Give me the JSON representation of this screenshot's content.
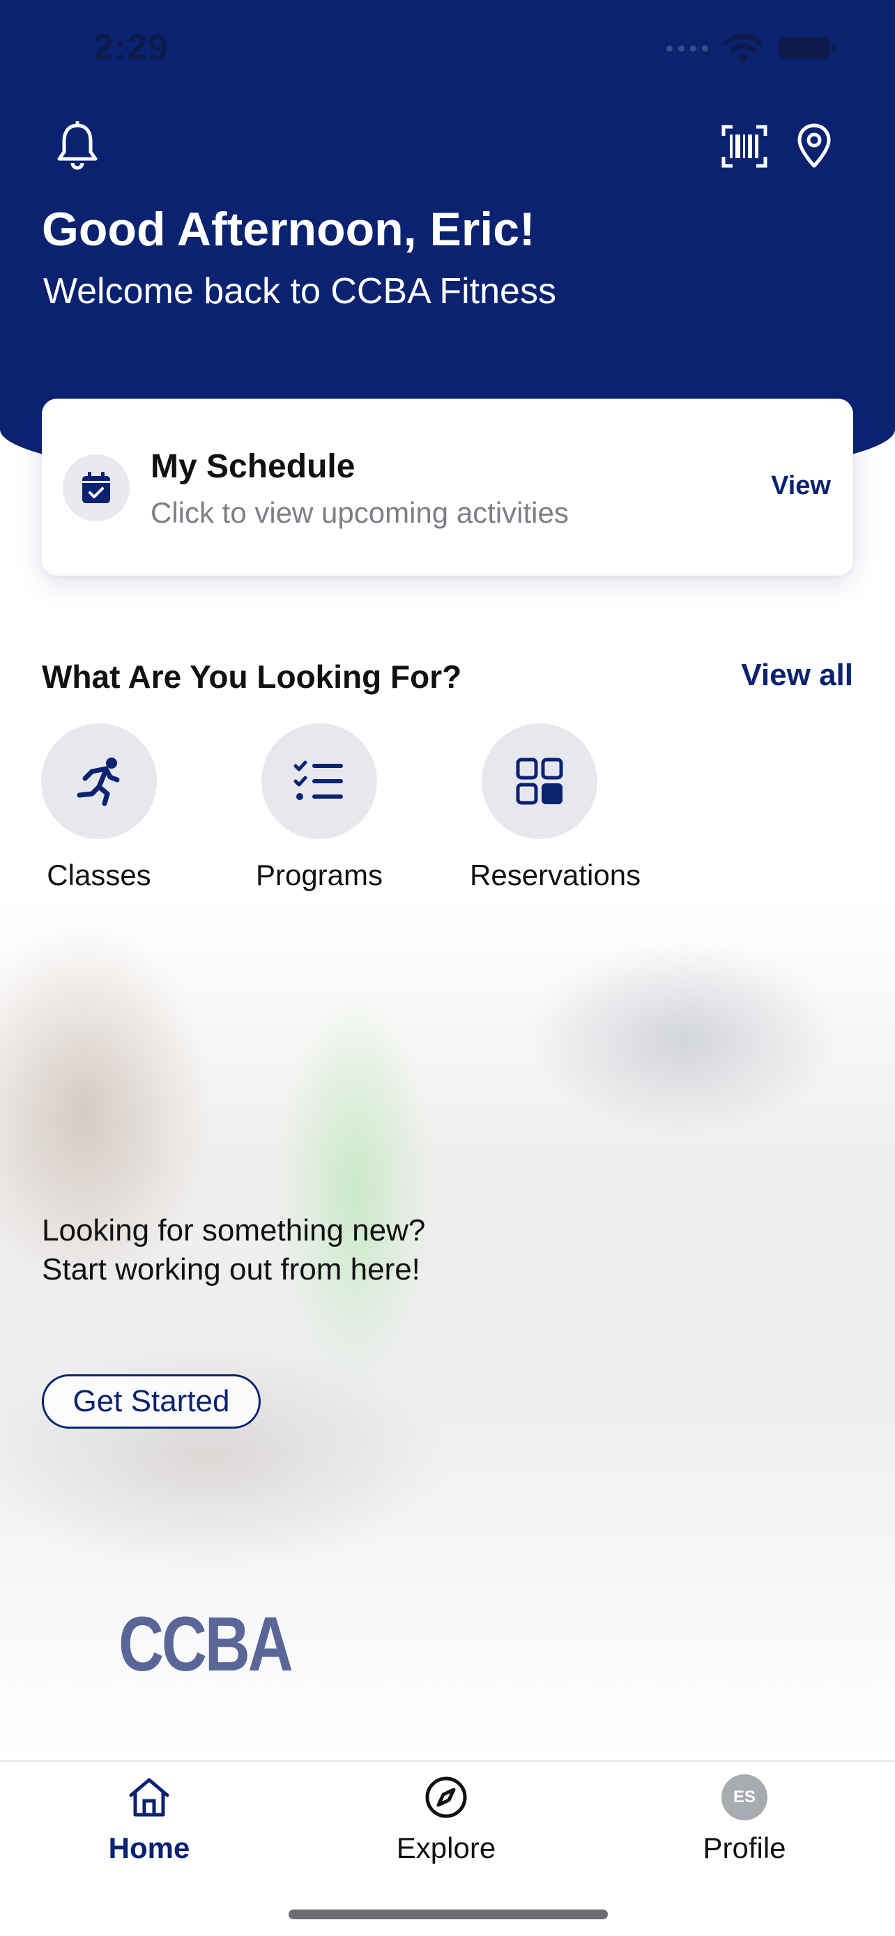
{
  "status_bar": {
    "time": "2:29"
  },
  "header": {
    "greeting": "Good Afternoon, Eric!",
    "welcome": "Welcome back to CCBA Fitness",
    "bg_color": "#0a2270"
  },
  "schedule_card": {
    "title": "My Schedule",
    "subtitle": "Click to view upcoming activities",
    "action": "View",
    "icon": "calendar-check-icon"
  },
  "section": {
    "title": "What Are You Looking For?",
    "view_all": "View all",
    "categories": [
      {
        "label": "Classes",
        "icon": "running-person-icon"
      },
      {
        "label": "Programs",
        "icon": "checklist-icon"
      },
      {
        "label": "Reservations",
        "icon": "grid-icon"
      }
    ]
  },
  "promo": {
    "line1": "Looking for something new?",
    "line2": "Start working out from here!",
    "button": "Get Started",
    "logo_text": "CCBA"
  },
  "tabbar": {
    "items": [
      {
        "label": "Home",
        "icon": "home-icon",
        "active": true
      },
      {
        "label": "Explore",
        "icon": "compass-icon",
        "active": false
      },
      {
        "label": "Profile",
        "icon": "avatar",
        "initials": "ES",
        "active": false
      }
    ]
  },
  "colors": {
    "accent": "#0a2270",
    "muted": "#7b7f86",
    "chip_bg": "#e6e8ee"
  }
}
